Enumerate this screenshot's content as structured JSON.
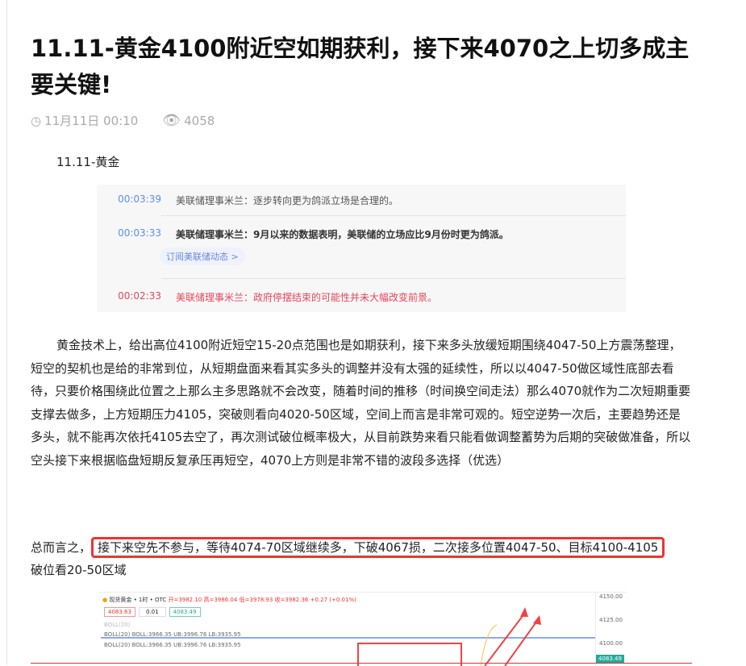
{
  "title": "11.11-黄金4100附近空如期获利，接下来4070之上切多成主要关键!",
  "meta": {
    "date": "11月11日 00:10",
    "views": "4058"
  },
  "subtitle": "11.11-黄金",
  "news": [
    {
      "time": "00:03:39",
      "text": "美联储理事米兰：逐步转向更为鸽派立场是合理的。"
    },
    {
      "time": "00:03:33",
      "text": "美联储理事米兰：9月以来的数据表明，美联储的立场应比9月份时更为鸽派。"
    },
    {
      "time": "00:02:33",
      "text": "美联储理事米兰：政府停摆结束的可能性并未大幅改变前景。"
    }
  ],
  "subscribe": "订阅美联储动态 >",
  "paragraph": "黄金技术上，给出高位4100附近短空15-20点范围也是如期获利，接下来多头放缓短期围绕4047-50上方震荡整理，短空的契机也是给的非常到位，从短期盘面来看其实多头的调整并没有太强的延续性，所以以4047-50做区域性底部去看待，只要价格围绕此位置之上那么主多思路就不会改变，随着时间的推移（时间换空间走法）那么4070就作为二次短期重要支撑去做多，上方短期压力4105，突破则看向4020-50区域，空间上而言是非常可观的。短空逆势一次后，主要趋势还是多头，就不能再次依托4105去空了，再次测试破位概率极大，从目前跌势来看只能看做调整蓄势为后期的突破做准备，所以空头接下来根据临盘短期反复承压再短空，4070上方则是非常不错的波段多选择（优选）",
  "summary": {
    "prefix": "总而言之，",
    "highlight": "接下来空先不参与，等待4074-70区域继续多，下破4067损，二次接多位置4047-50、目标4100-4105",
    "suffix": "破位看20-50区域"
  },
  "chart": {
    "header": "现货黄金 • 1时 • OTC",
    "ohlc": "开=3982.10 高=3986.04 低=3978.93 收=3982.36 +0.27 (+0.01%)",
    "ask": "4083.63",
    "spread": "0.01",
    "bid": "4083.49",
    "boll_label": "BOLL(20)",
    "boll1": "BOLL(20) BOLL:3966.35 UB:3996.76 LB:3935.95",
    "boll2": "BOLL(20) BOLL:3966.35 UB:3996.76 LB:3935.95",
    "axis": [
      "4150.00",
      "4125.00",
      "4100.00"
    ],
    "price": "4083.49",
    "colors": {
      "up": "#e33",
      "down": "#2a9"
    }
  }
}
